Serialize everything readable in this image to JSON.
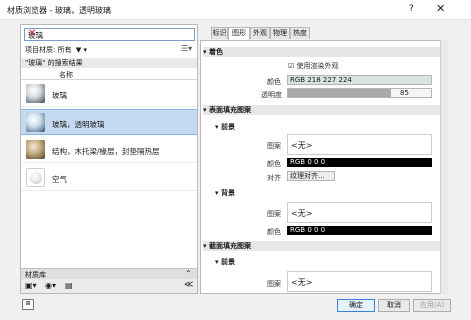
{
  "window": {
    "title": "材质浏览器 - 玻璃，透明玻璃",
    "help": "?",
    "close": "✕"
  },
  "search": {
    "value": "玻璃",
    "clear": "✕"
  },
  "filter": {
    "label": "项目材质: 所有",
    "funnel": "▼",
    "dropdown": "▾",
    "list_icon": "☰▾"
  },
  "results": {
    "caption": "\"玻璃\" 的搜索结果",
    "column": "名称"
  },
  "materials": [
    {
      "name": "玻璃"
    },
    {
      "name": "玻璃，透明玻璃"
    },
    {
      "name": "结构，木托梁/椽层，封垫隔热层"
    },
    {
      "name": "空气"
    }
  ],
  "library": {
    "label": "材质库",
    "collapse": "⌃",
    "toolbar_icons": [
      "▣▾",
      "◉▾",
      "▤"
    ],
    "expand": "≪"
  },
  "tabs": [
    "标识",
    "图形",
    "外观",
    "物理",
    "热度"
  ],
  "shading": {
    "section": "着色",
    "use_render": "使用渲染外观",
    "use_render_checked": true,
    "color_label": "颜色",
    "color_value": "RGB 218 227 224",
    "transparency_label": "透明度",
    "transparency_value": "85",
    "transparency_level": 0.85,
    "swatch": "#dae3e0"
  },
  "surface": {
    "section": "表面填充图案",
    "foreground": "前景",
    "pattern_label": "图案",
    "pattern_value": "<无>",
    "color_label": "颜色",
    "color_value": "RGB 0 0 0",
    "align_label": "对齐",
    "align_value": "纹理对齐...",
    "background": "背景",
    "bg_pattern_label": "图案",
    "bg_pattern_value": "<无>",
    "bg_color_label": "颜色",
    "bg_color_value": "RGB 0 0 0"
  },
  "cut": {
    "section": "截面填充图案",
    "foreground": "前景",
    "pattern_label": "图案",
    "pattern_value": "<无>"
  },
  "buttons": {
    "ok": "确定",
    "cancel": "取消",
    "apply": "应用(A)"
  },
  "colors": {
    "selection": "#c5d9f1",
    "clear_icon": "#d21919",
    "black_swatch": "#000000"
  }
}
